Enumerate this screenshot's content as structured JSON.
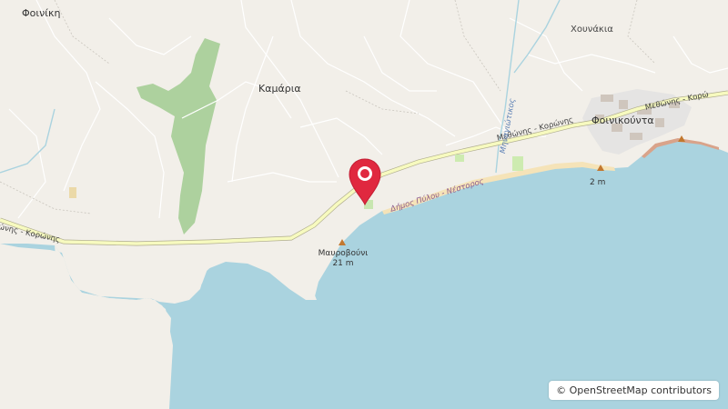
{
  "map": {
    "labels": {
      "foiniki": "Φοινίκη",
      "kamaria": "Καμάρια",
      "chounakia": "Χουνάκια",
      "foinikounta": "Φοινικούντα",
      "mavrovouni": "Μαυροβούνι",
      "mavrovouni_elev": "21 m",
      "foinikounta_elev": "2 m",
      "road_left": "θώνης - Κορώνης",
      "road_mid": "Μεθώνης - Κορώνης",
      "road_right": "Μεθώνης - Κορώ",
      "stream": "Μηναγιώτικος",
      "coast_road": "Δήμος Πύλου - Νέστορος"
    },
    "colors": {
      "land": "#f2efe9",
      "sea": "#aad3df",
      "forest": "#add19e",
      "main_road": "#f7fabf",
      "beach": "#f5e3b8",
      "marker": "#e0283f"
    }
  },
  "attribution": {
    "icon": "copyright-icon",
    "text": "© OpenStreetMap contributors"
  },
  "marker": {
    "icon": "map-pin-icon"
  }
}
